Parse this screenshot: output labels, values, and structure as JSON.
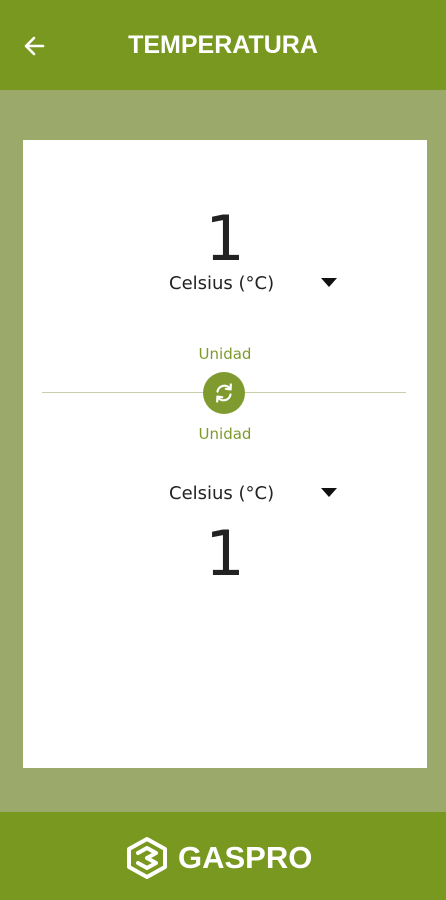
{
  "header": {
    "title": "TEMPERATURA",
    "back_icon": "arrow-left-icon"
  },
  "converter": {
    "from_value": "1",
    "from_unit": "Celsius (°C)",
    "from_caption": "Unidad",
    "to_caption": "Unidad",
    "to_unit": "Celsius (°C)",
    "to_value": "1",
    "swap_icon": "swap-refresh-icon"
  },
  "footer": {
    "brand": "GASPRO"
  },
  "colors": {
    "header_bg": "#78981f",
    "page_bg": "#9ba96a",
    "accent": "#7f9a2e",
    "card_bg": "#ffffff"
  }
}
